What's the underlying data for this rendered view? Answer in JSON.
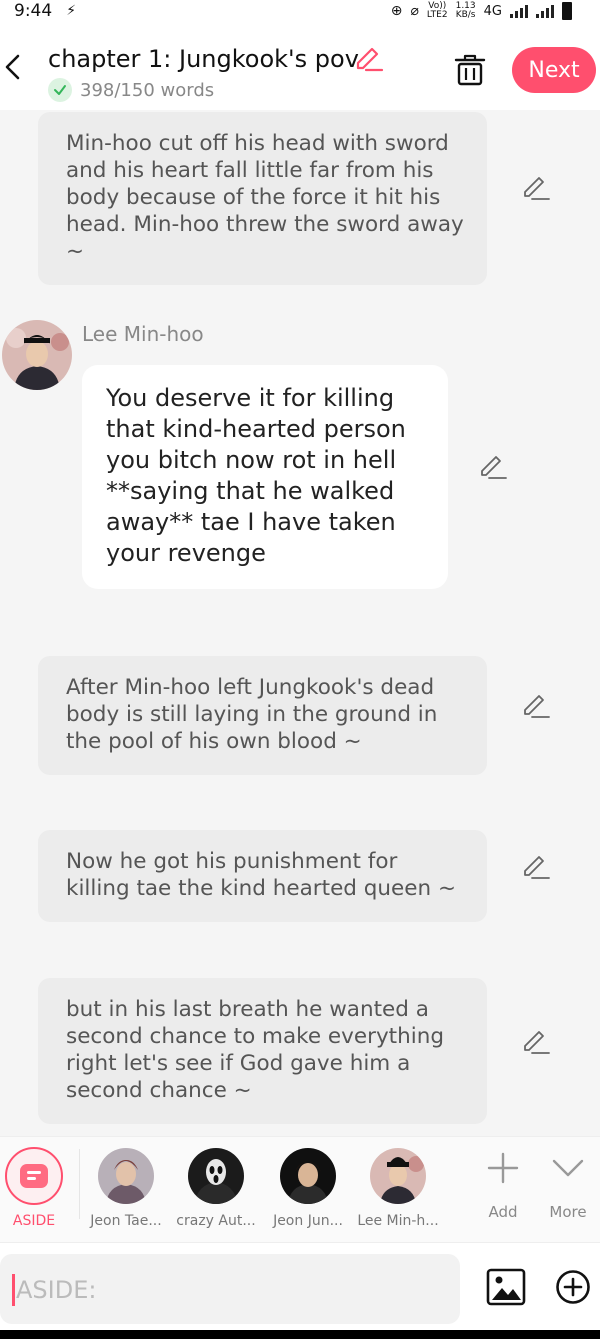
{
  "status_bar": {
    "time": "9:44",
    "network": "4G",
    "lte_top": "Vo))",
    "lte_bottom": "LTE2",
    "speed_top": "1.13",
    "speed_bottom": "KB/s"
  },
  "header": {
    "title": "chapter 1: Jungkook's pov",
    "word_count": "398/150 words",
    "next_label": "Next"
  },
  "messages": [
    {
      "type": "narration",
      "text": "Min-hoo cut off his head with sword and his heart fall little far from his body because of the force it hit his head. Min-hoo threw the sword away ~"
    },
    {
      "type": "dialogue",
      "speaker": "Lee Min-hoo",
      "text": "You deserve it for killing that kind-hearted person you bitch now rot in hell **saying that he walked away** tae I have taken your revenge"
    },
    {
      "type": "narration",
      "text": "After Min-hoo left Jungkook's dead body is still laying in the ground in the pool of his own blood ~"
    },
    {
      "type": "narration",
      "text": "Now he got his punishment for killing tae the kind hearted queen ~"
    },
    {
      "type": "narration",
      "text": "but in his last breath he wanted a second chance to make everything right let's see if God gave him a second chance ~"
    }
  ],
  "characters": [
    {
      "label": "ASIDE",
      "active": true
    },
    {
      "label": "Jeon Tae...",
      "active": false
    },
    {
      "label": "crazy Aut...",
      "active": false
    },
    {
      "label": "Jeon Jun...",
      "active": false
    },
    {
      "label": "Lee Min-h...",
      "active": false
    }
  ],
  "char_actions": {
    "add_label": "Add",
    "more_label": "More"
  },
  "input": {
    "placeholder": "ASIDE:"
  },
  "colors": {
    "accent": "#ff4f6e",
    "narration_bg": "#ececec",
    "content_bg": "#f5f5f5"
  }
}
